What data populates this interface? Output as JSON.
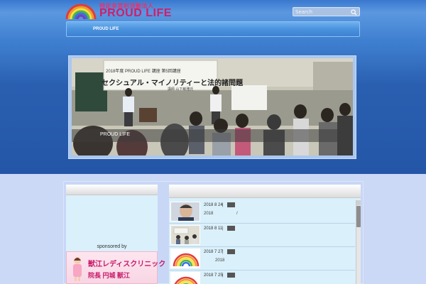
{
  "header": {
    "logo_subtitle": "特定非営利活動法人",
    "logo_title": "PROUD LIFE",
    "search_placeholder": "Search"
  },
  "nav": {
    "items": [
      {
        "label": "PROUD LIFE"
      }
    ]
  },
  "hero": {
    "banner_line1": "2018年度 PROUD LIFE 講座 第5回講座",
    "banner_line2": "セクシュアル・マイノリティーと法的諸問題",
    "banner_line3": "講師 山下敏雅氏",
    "caption": "PROUD LIFE"
  },
  "sidebar": {
    "sponsor_label": "sponsored by",
    "sponsor_clinic": "獣江レディスクリニック",
    "sponsor_staff": "院長 円城 獣江"
  },
  "news": [
    {
      "date": "2018 8 24",
      "sep": "|",
      "excerpt": "2018",
      "excerpt2": "/",
      "thumb": "person"
    },
    {
      "date": "2018 8 11",
      "sep": "|",
      "excerpt": "",
      "excerpt2": "",
      "thumb": "meeting"
    },
    {
      "date": "2018 7 27",
      "sep": "|",
      "excerpt": "2018",
      "excerpt2": "",
      "thumb": "rainbow"
    },
    {
      "date": "2018 7 25",
      "sep": "|",
      "excerpt": "",
      "excerpt2": "",
      "thumb": "rainbow"
    }
  ],
  "colors": {
    "brand_pink": "#d11d6b",
    "header_blue": "#3f7fd0",
    "content_bg": "#daf0fb"
  }
}
